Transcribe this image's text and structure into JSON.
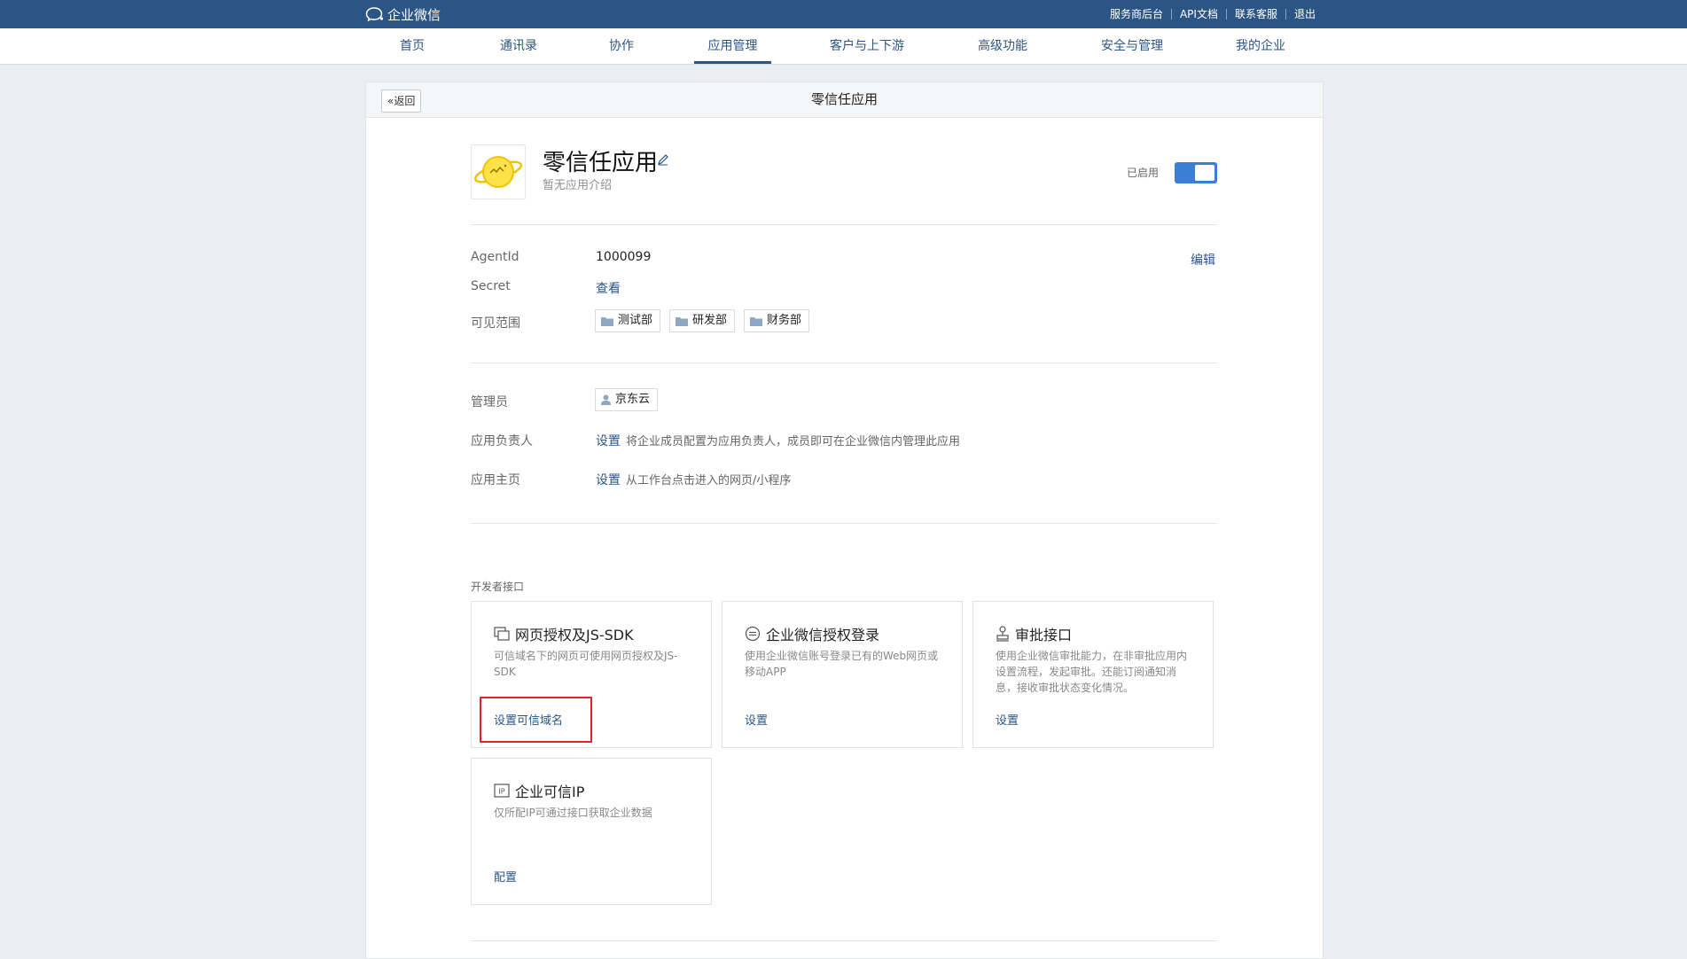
{
  "topbar": {
    "brand": "企业微信",
    "links": [
      "服务商后台",
      "API文档",
      "联系客服",
      "退出"
    ]
  },
  "nav": {
    "items": [
      "首页",
      "通讯录",
      "协作",
      "应用管理",
      "客户与上下游",
      "高级功能",
      "安全与管理",
      "我的企业"
    ],
    "active": "应用管理"
  },
  "header": {
    "back_label": "返回",
    "title": "零信任应用"
  },
  "app": {
    "name": "零信任应用",
    "description": "暂无应用介绍",
    "status_label": "已启用",
    "enabled": true
  },
  "info": {
    "agentid_label": "AgentId",
    "agentid_value": "1000099",
    "edit_label": "编辑",
    "secret_label": "Secret",
    "secret_link": "查看",
    "scope_label": "可见范围",
    "scope_tags": [
      "测试部",
      "研发部",
      "财务部"
    ]
  },
  "admin": {
    "admin_label": "管理员",
    "admin_value": "京东云",
    "owner_label": "应用负责人",
    "owner_link": "设置",
    "owner_hint": "将企业成员配置为应用负责人，成员即可在企业微信内管理此应用",
    "home_label": "应用主页",
    "home_link": "设置",
    "home_hint": "从工作台点击进入的网页/小程序"
  },
  "dev": {
    "section_label": "开发者接口",
    "cards": [
      {
        "icon": "web-auth-icon",
        "title": "网页授权及JS-SDK",
        "desc": "可信域名下的网页可使用网页授权及JS-SDK",
        "action": "设置可信域名"
      },
      {
        "icon": "wecom-login-icon",
        "title": "企业微信授权登录",
        "desc": "使用企业微信账号登录已有的Web网页或移动APP",
        "action": "设置"
      },
      {
        "icon": "approval-icon",
        "title": "审批接口",
        "desc": "使用企业微信审批能力，在非审批应用内设置流程，发起审批。还能订阅通知消息，接收审批状态变化情况。",
        "action": "设置"
      },
      {
        "icon": "ip-icon",
        "title": "企业可信IP",
        "desc": "仅所配IP可通过接口获取企业数据",
        "action": "配置"
      }
    ]
  },
  "colors": {
    "topbar": "#2b5585",
    "link": "#2b5585",
    "toggle": "#3a7fd5",
    "highlight": "#e0222b"
  }
}
